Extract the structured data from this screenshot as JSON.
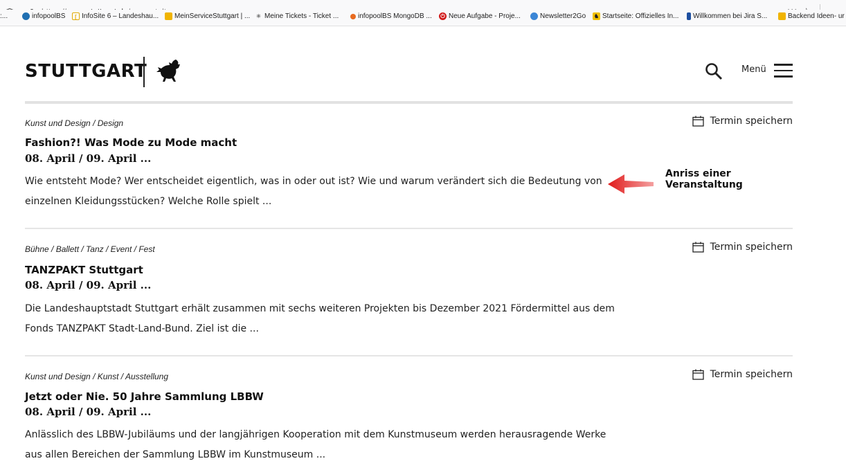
{
  "browser": {
    "url_prefix": "https://www.",
    "url_domain": "stuttgart.de",
    "url_path": "/veranstaltungen",
    "more_glyph": "···",
    "star_glyph": "☆"
  },
  "bookmarks": [
    {
      "label": ":...",
      "icon": "bookmark-edge-icon",
      "color": "#9a9a9a"
    },
    {
      "label": "infopoolBS",
      "icon": "infopool-icon",
      "color": "#1f6fb2"
    },
    {
      "label": "InfoSite 6 – Landeshau...",
      "icon": "infosite-icon",
      "color": "#e0a800"
    },
    {
      "label": "MeinServiceStuttgart | ...",
      "icon": "confluence-icon",
      "color": "#f0b400"
    },
    {
      "label": "Meine Tickets - Ticket ...",
      "icon": "ticket-icon",
      "color": "#777777"
    },
    {
      "label": "infopoolBS MongoDB ...",
      "icon": "mongodb-icon",
      "color": "#e86a1f"
    },
    {
      "label": "Neue Aufgabe - Proje...",
      "icon": "power-icon",
      "color": "#d11a1a"
    },
    {
      "label": "Newsletter2Go",
      "icon": "newsletter-icon",
      "color": "#3b86d6"
    },
    {
      "label": "Startseite: Offizielles In...",
      "icon": "stuttgart-horse-icon",
      "color": "#f0c000"
    },
    {
      "label": "Willkommen bei Jira S...",
      "icon": "jira-icon",
      "color": "#1d4fa0"
    },
    {
      "label": "Backend Ideen- ur",
      "icon": "confluence-icon",
      "color": "#f0b400"
    }
  ],
  "header": {
    "logo_text": "STUTTGART",
    "menu_label": "Menü"
  },
  "events": [
    {
      "category": "Kunst und Design / Design",
      "title": "Fashion?! Was Mode zu Mode macht",
      "date": "08. April / 09. April ...",
      "description": "Wie entsteht Mode? Wer entscheidet eigentlich, was in oder out ist? Wie und warum verändert sich die Bedeutung von einzelnen Kleidungsstücken? Welche Rolle spielt ...",
      "save_label": "Termin speichern"
    },
    {
      "category": "Bühne / Ballett / Tanz / Event / Fest",
      "title": "TANZPAKT Stuttgart",
      "date": "08. April / 09. April ...",
      "description": "Die Landeshauptstadt Stuttgart erhält zusammen mit sechs weiteren Projekten bis Dezember 2021 Fördermittel aus dem Fonds TANZPAKT Stadt-Land-Bund. Ziel ist die ...",
      "save_label": "Termin speichern"
    },
    {
      "category": "Kunst und Design / Kunst / Ausstellung",
      "title": "Jetzt oder Nie. 50 Jahre Sammlung LBBW",
      "date": "08. April / 09. April ...",
      "description": "Anlässlich des LBBW-Jubiläums und der langjährigen Kooperation mit dem Kunstmuseum werden herausragende Werke aus allen Bereichen der Sammlung LBBW im Kunstmuseum ...",
      "save_label": "Termin speichern"
    }
  ],
  "annotation": {
    "line1": "Anriss einer",
    "line2": "Veranstaltung",
    "arrow_color": "#e01b1b"
  }
}
